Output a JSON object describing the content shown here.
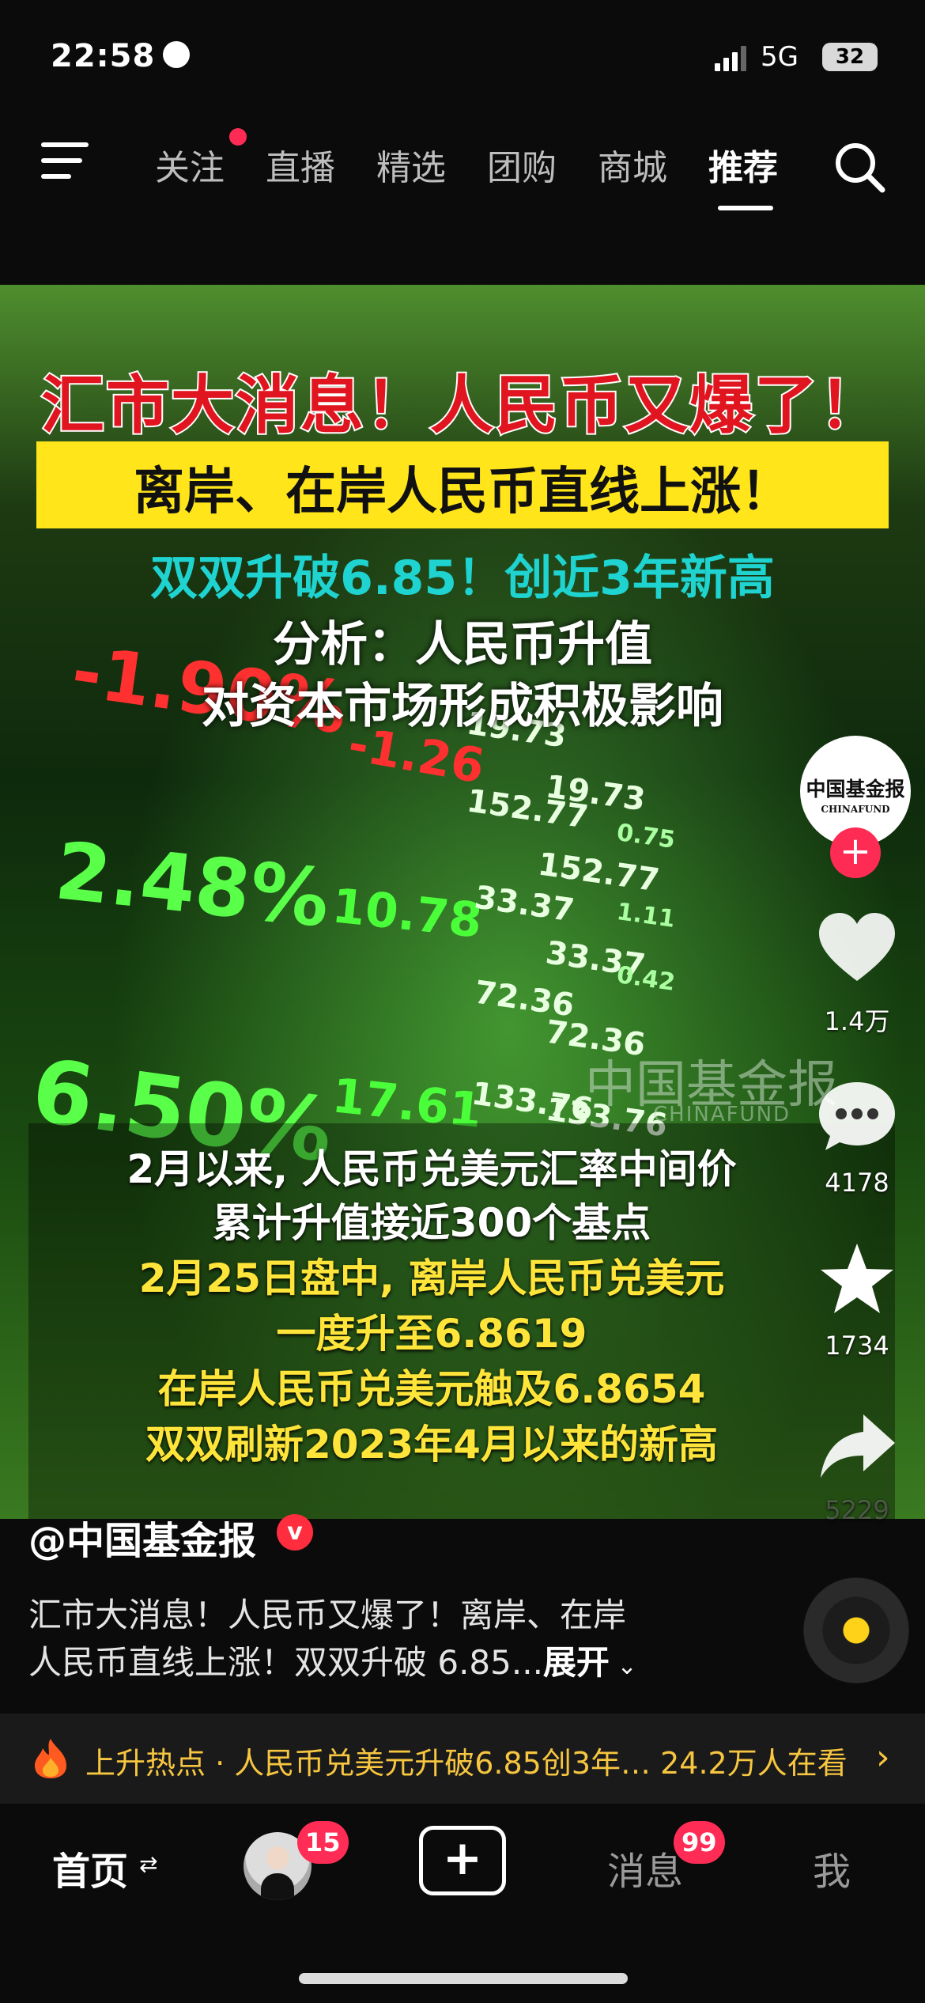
{
  "status_bar": {
    "time": "22:58",
    "network": "5G",
    "battery": "32"
  },
  "top_nav": {
    "tabs": [
      {
        "label": "关注",
        "active": false,
        "has_dot": true
      },
      {
        "label": "直播",
        "active": false
      },
      {
        "label": "精选",
        "active": false
      },
      {
        "label": "团购",
        "active": false
      },
      {
        "label": "商城",
        "active": false
      },
      {
        "label": "推荐",
        "active": true
      }
    ]
  },
  "video": {
    "headline1": "汇市大消息！人民币又爆了！",
    "headline2": "离岸、在岸人民币直线上涨！",
    "headline3": "双双升破6.85！创近3年新高",
    "headline4": "分析：人民币升值",
    "headline5": "对资本市场形成积极影响",
    "background_tickers": [
      "-1.90%",
      "2.48%",
      "6.50%",
      "10.78",
      "17.61",
      "-1.26",
      "19.73",
      "152.77",
      "33.37",
      "72.36",
      "133.76",
      "19.73",
      "152.77",
      "33.37",
      "72.36",
      "133.76",
      "1.11",
      "0.42",
      "0.75"
    ],
    "watermark_cn": "中国基金报",
    "watermark_en": "CHINAFUND",
    "captions": [
      {
        "text": "2月以来, 人民币兑美元汇率中间价",
        "color": "white"
      },
      {
        "text": "累计升值接近300个基点",
        "color": "white"
      },
      {
        "text": "2月25日盘中, 离岸人民币兑美元",
        "color": "yellow"
      },
      {
        "text": "一度升至6.8619",
        "color": "yellow"
      },
      {
        "text": "在岸人民币兑美元触及6.8654",
        "color": "yellow"
      },
      {
        "text": "双双刷新2023年4月以来的新高",
        "color": "yellow"
      }
    ]
  },
  "actions": {
    "avatar_cn": "中国基金报",
    "avatar_en": "CHINAFUND",
    "follow": "+",
    "likes": "1.4万",
    "comments": "4178",
    "favorites": "1734",
    "shares": "5229"
  },
  "post": {
    "author": "@中国基金报",
    "verified": "v",
    "description_line1": "汇市大消息！人民币又爆了！离岸、在岸",
    "description_line2": "人民币直线上涨！双双升破 6.85...",
    "expand": "展开"
  },
  "hot_bar": {
    "text": "上升热点 · 人民币兑美元升破6.85创3年…  24.2万人在看"
  },
  "tab_bar": {
    "home": "首页",
    "friends_badge": "15",
    "create": "+",
    "messages": "消息",
    "messages_badge": "99",
    "me": "我"
  },
  "colors": {
    "accent": "#fe2c55",
    "hot": "#f7c640",
    "headline_red": "#e0151f",
    "headline_yellow_bg": "#ffe51a",
    "headline_cyan": "#1fd3d0"
  }
}
